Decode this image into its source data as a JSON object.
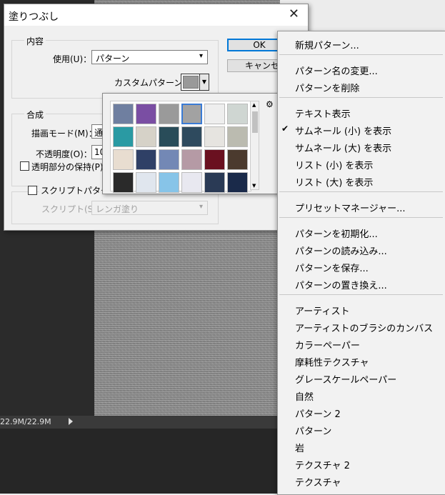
{
  "status": {
    "doc_size": "22.9M/22.9M"
  },
  "dialog": {
    "title": "塗りつぶし",
    "content_group": "内容",
    "use_label": "使用(U)：",
    "use_value": "パターン",
    "custom_pattern_label": "カスタムパターン：",
    "blend_group": "合成",
    "mode_label": "描画モード(M)：",
    "mode_value": "通",
    "opacity_label": "不透明度(O)：",
    "opacity_value": "10",
    "preserve_label": "透明部分の保持(P)",
    "script_check_label": "スクリプトパターン",
    "script_label": "スクリプト(S)：",
    "script_value": "レンガ塗り",
    "ok": "OK",
    "cancel": "キャンセル"
  },
  "menu": {
    "groups": [
      [
        {
          "label": "新規パターン..."
        }
      ],
      [
        {
          "label": "パターン名の変更..."
        },
        {
          "label": "パターンを削除"
        }
      ],
      [
        {
          "label": "テキスト表示"
        },
        {
          "label": "サムネール (小) を表示",
          "checked": true
        },
        {
          "label": "サムネール (大) を表示"
        },
        {
          "label": "リスト (小) を表示"
        },
        {
          "label": "リスト (大) を表示"
        }
      ],
      [
        {
          "label": "プリセットマネージャー..."
        }
      ],
      [
        {
          "label": "パターンを初期化..."
        },
        {
          "label": "パターンの読み込み..."
        },
        {
          "label": "パターンを保存..."
        },
        {
          "label": "パターンの置き換え..."
        }
      ],
      [
        {
          "label": "アーティスト"
        },
        {
          "label": "アーティストのブラシのカンバス"
        },
        {
          "label": "カラーペーパー"
        },
        {
          "label": "摩耗性テクスチャ"
        },
        {
          "label": "グレースケールペーパー"
        },
        {
          "label": "自然"
        },
        {
          "label": "パターン 2"
        },
        {
          "label": "パターン"
        },
        {
          "label": "岩"
        },
        {
          "label": "テクスチャ 2"
        },
        {
          "label": "テクスチャ"
        }
      ]
    ]
  },
  "pattern_swatches": [
    "#6f7fa0",
    "#7a4ea3",
    "#9a9a9a",
    "#a2a2a2",
    "#eeeeee",
    "#cfd6d2",
    "#2a9aa3",
    "#d6d2c8",
    "#294c59",
    "#2e4a5e",
    "#e6e4e0",
    "#bbbbb0",
    "#e8ddd0",
    "#2f4066",
    "#7388b5",
    "#b59aa5",
    "#6a1020",
    "#4b3a2e",
    "#2a2a2a",
    "#e0e6ee",
    "#87c4e8",
    "#e8e8f0",
    "#2a3a55",
    "#1a2a4a"
  ]
}
